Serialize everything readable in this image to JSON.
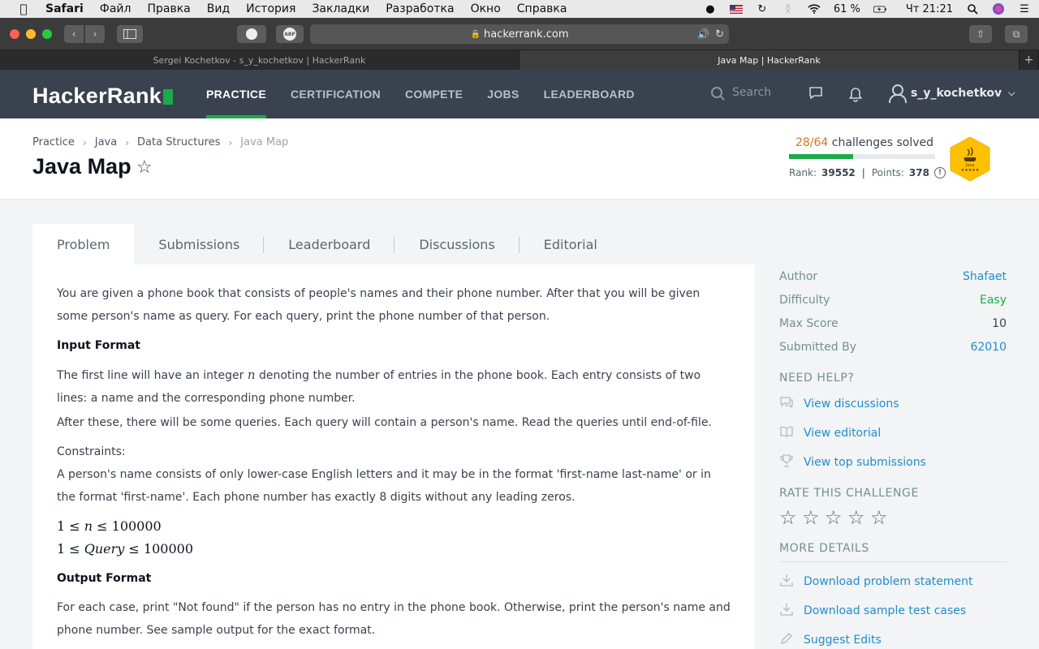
{
  "menubar": {
    "app": "Safari",
    "items": [
      "Файл",
      "Правка",
      "Вид",
      "История",
      "Закладки",
      "Разработка",
      "Окно",
      "Справка"
    ],
    "battery": "61 %",
    "clock": "Чт 21:21"
  },
  "browser": {
    "address": "hackerrank.com",
    "tabs": [
      {
        "title": "Sergei Kochetkov - s_y_kochetkov | HackerRank"
      },
      {
        "title": "Java Map | HackerRank"
      }
    ]
  },
  "nav": {
    "logo": "HackerRank",
    "links": [
      "PRACTICE",
      "CERTIFICATION",
      "COMPETE",
      "JOBS",
      "LEADERBOARD"
    ],
    "search_placeholder": "Search",
    "username": "s_y_kochetkov"
  },
  "header": {
    "breadcrumbs": [
      "Practice",
      "Java",
      "Data Structures",
      "Java Map"
    ],
    "title": "Java Map",
    "solved": "28/64",
    "solved_label": "challenges solved",
    "solved_fraction": 0.4375,
    "rank_label": "Rank:",
    "rank": "39552",
    "points_label": "Points:",
    "points": "378",
    "badge_label": "Java"
  },
  "tabs": [
    "Problem",
    "Submissions",
    "Leaderboard",
    "Discussions",
    "Editorial"
  ],
  "problem": {
    "intro": "You are given a phone book that consists of people's names and their phone number. After that you will be given some person's name as query. For each query, print the phone number of that person.",
    "input_heading": "Input Format",
    "input_pre": "The first line will have an integer",
    "input_var": "n",
    "input_post": "denoting the number of entries in the phone book. Each entry consists of two lines: a name and the corresponding phone number.",
    "queries": "After these, there will be some queries. Each query will contain a person's name. Read the queries until end-of-file.",
    "constraints_label": "Constraints:",
    "constraints_text": "A person's name consists of only lower-case English letters and it may be in the format 'first-name last-name' or in the format 'first-name'. Each phone number has exactly 8 digits without any leading zeros.",
    "math1": "1 ≤ 𝑛 ≤ 100000",
    "math2": "1 ≤ 𝑄𝑢𝑒𝑟𝑦 ≤ 100000",
    "output_heading": "Output Format",
    "output_text": "For each case, print \"Not found\" if the person has no entry in the phone book. Otherwise, print the person's name and phone number. See sample output for the exact format."
  },
  "sidebar": {
    "details": [
      {
        "k": "Author",
        "v": "Shafaet"
      },
      {
        "k": "Difficulty",
        "v": "Easy"
      },
      {
        "k": "Max Score",
        "v": "10"
      },
      {
        "k": "Submitted By",
        "v": "62010"
      }
    ],
    "need_help": "NEED HELP?",
    "help_links": [
      "View discussions",
      "View editorial",
      "View top submissions"
    ],
    "rate_heading": "RATE THIS CHALLENGE",
    "more_heading": "MORE DETAILS",
    "more_links": [
      "Download problem statement",
      "Download sample test cases",
      "Suggest Edits"
    ]
  },
  "colors": {
    "brand_green": "#1ba94c",
    "nav_bg": "#39424e",
    "link_blue": "#1f8ecd",
    "solved_orange": "#d4741f"
  }
}
